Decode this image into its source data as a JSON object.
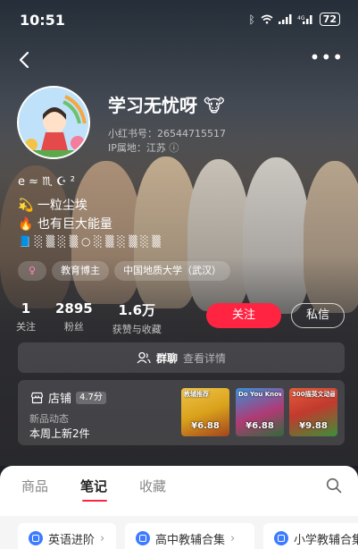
{
  "status_bar": {
    "time": "10:51",
    "battery": "72"
  },
  "profile": {
    "name": "学习无忧呀",
    "name_emoji": "🐮",
    "red_id": "小红书号：26544715517",
    "ip_location": "IP属地：江苏",
    "bio_lines": [
      "e ≈ ♏ ☪ ²",
      "一粒尘埃",
      "也有巨大能量",
      "░ ▒ ░ ▒ ○ ░ ▒ ░ ▒ ░ ▒"
    ],
    "bio_emojis": [
      "💫",
      "🔥",
      "📘"
    ],
    "tags": [
      "♀",
      "教育博主",
      "中国地质大学（武汉）"
    ]
  },
  "stats": [
    {
      "value": "1",
      "label": "关注"
    },
    {
      "value": "2895",
      "label": "粉丝"
    },
    {
      "value": "1.6万",
      "label": "获赞与收藏"
    }
  ],
  "actions": {
    "follow": "关注",
    "message": "私信"
  },
  "group_chat": {
    "label": "群聊",
    "detail": "查看详情"
  },
  "shop": {
    "title": "店铺",
    "rating": "4.7分",
    "subtitle": "新品动态",
    "update": "本周上新2件",
    "products": [
      {
        "caption": "教辅推荐",
        "price": "¥6.88",
        "color": "#d9a21b"
      },
      {
        "caption": "Do You Know?",
        "price": "¥6.88",
        "color": "#b03a74"
      },
      {
        "caption": "300描英文动画片",
        "price": "¥9.88",
        "color": "#c23a2e"
      }
    ]
  },
  "tabs": [
    "商品",
    "笔记",
    "收藏"
  ],
  "active_tab": "笔记",
  "collections": [
    "英语进阶",
    "高中教辅合集",
    "小学教辅合集"
  ],
  "colors": {
    "accent": "#ff2442",
    "chip_icon": "#3d7bff"
  }
}
